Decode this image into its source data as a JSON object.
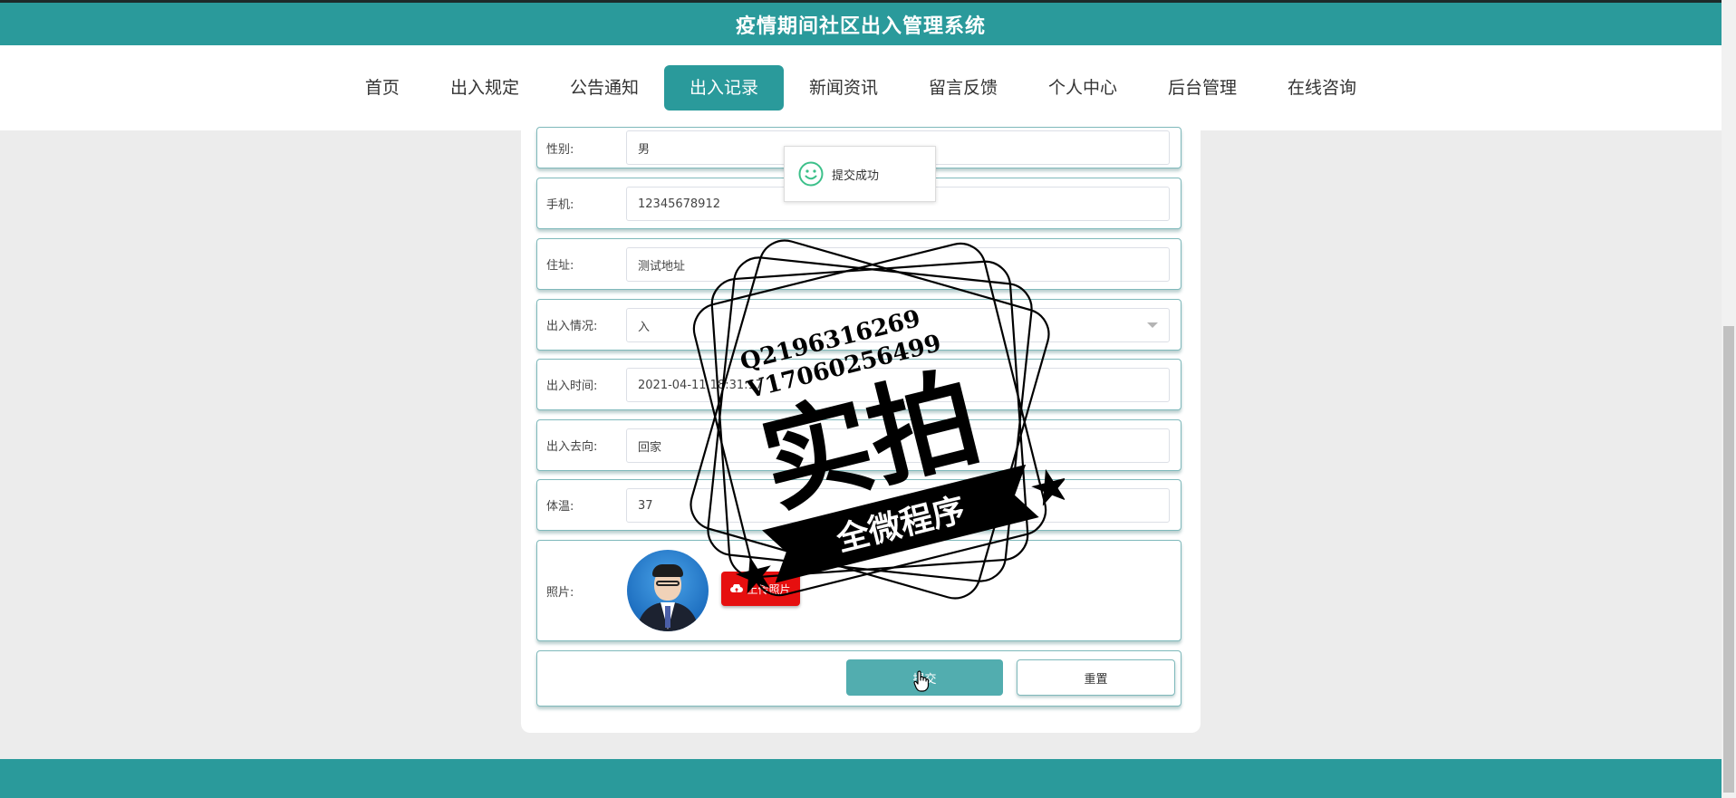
{
  "header": {
    "title": "疫情期间社区出入管理系统"
  },
  "nav": {
    "items": [
      {
        "label": "首页"
      },
      {
        "label": "出入规定"
      },
      {
        "label": "公告通知"
      },
      {
        "label": "出入记录"
      },
      {
        "label": "新闻资讯"
      },
      {
        "label": "留言反馈"
      },
      {
        "label": "个人中心"
      },
      {
        "label": "后台管理"
      },
      {
        "label": "在线咨询"
      }
    ],
    "active": "出入记录"
  },
  "form": {
    "gender": {
      "label": "性别:",
      "value": "男"
    },
    "phone": {
      "label": "手机:",
      "value": "12345678912"
    },
    "address": {
      "label": "住址:",
      "value": "测试地址"
    },
    "status": {
      "label": "出入情况:",
      "value": "入"
    },
    "time": {
      "label": "出入时间:",
      "value": "2021-04-11 18:31:17"
    },
    "destination": {
      "label": "出入去向:",
      "value": "回家"
    },
    "temperature": {
      "label": "体温:",
      "value": "37"
    },
    "photo": {
      "label": "照片:",
      "upload_label": "上传照片"
    },
    "submit_label": "提交",
    "reset_label": "重置"
  },
  "toast": {
    "message": "提交成功"
  },
  "watermark": {
    "line1": "Q2196316269",
    "line2": "V17060256499",
    "main": "实拍",
    "banner": "全微程序"
  },
  "colors": {
    "primary": "#2a9a9b",
    "submit": "#52adaf",
    "upload": "#e60f0f"
  }
}
